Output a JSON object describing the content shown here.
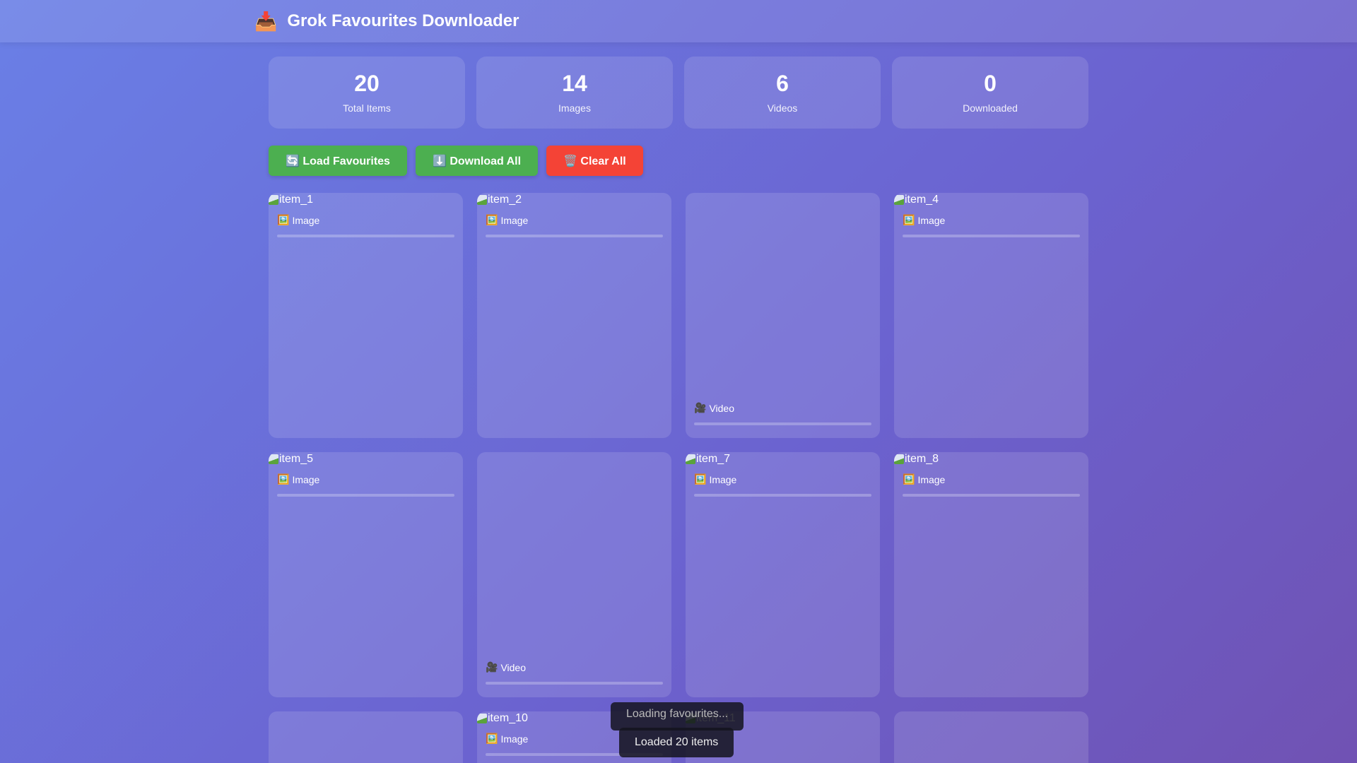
{
  "header": {
    "title": "Grok Favourites Downloader",
    "icon": "inbox-tray-icon"
  },
  "stats": [
    {
      "value": "20",
      "label": "Total Items"
    },
    {
      "value": "14",
      "label": "Images"
    },
    {
      "value": "6",
      "label": "Videos"
    },
    {
      "value": "0",
      "label": "Downloaded"
    }
  ],
  "actions": {
    "load": "🔄 Load Favourites",
    "download": "⬇️ Download All",
    "clear": "🗑️ Clear All"
  },
  "items": [
    {
      "alt": "item_1",
      "type": "image",
      "label": "Image",
      "progress": 0
    },
    {
      "alt": "item_2",
      "type": "image",
      "label": "Image",
      "progress": 0
    },
    {
      "alt": "",
      "type": "video",
      "label": "Video",
      "progress": 0
    },
    {
      "alt": "item_4",
      "type": "image",
      "label": "Image",
      "progress": 0
    },
    {
      "alt": "item_5",
      "type": "image",
      "label": "Image",
      "progress": 0
    },
    {
      "alt": "",
      "type": "video",
      "label": "Video",
      "progress": 0
    },
    {
      "alt": "item_7",
      "type": "image",
      "label": "Image",
      "progress": 0
    },
    {
      "alt": "item_8",
      "type": "image",
      "label": "Image",
      "progress": 0
    },
    {
      "alt": "",
      "type": "video",
      "label": "",
      "progress": 0
    },
    {
      "alt": "item_10",
      "type": "image",
      "label": "Image",
      "progress": 0
    },
    {
      "alt": "item_11",
      "type": "image",
      "label": "",
      "progress": 0
    },
    {
      "alt": "",
      "type": "video",
      "label": "",
      "progress": 0
    }
  ],
  "toasts": [
    "Loading favourites...",
    "Loaded 20 items"
  ]
}
